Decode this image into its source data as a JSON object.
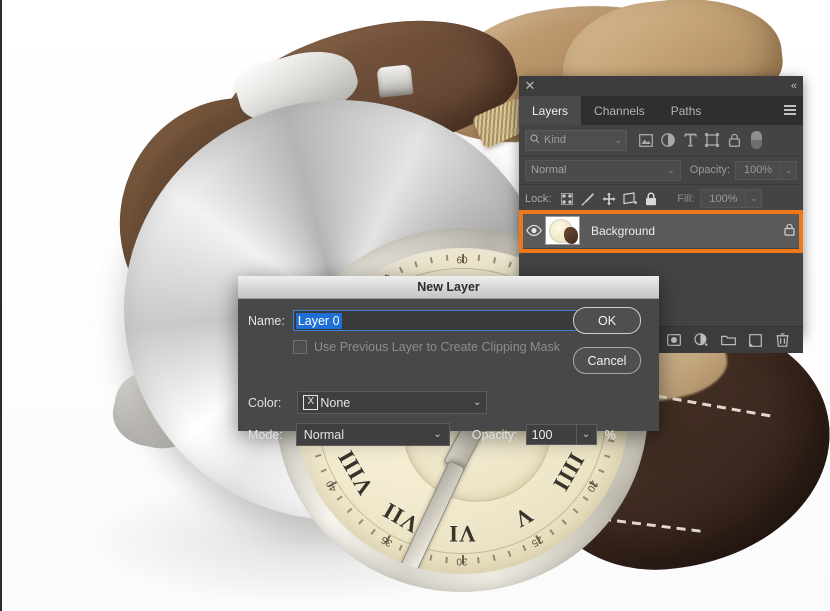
{
  "canvas": {
    "photo_subject": "wristwatch-product-photo",
    "description": "Silver chronograph wristwatch with cream dial, roman numerals and brown leather strap on white background"
  },
  "layers_panel": {
    "close_icon": "✕",
    "collapse_icon": "«",
    "tabs": [
      {
        "label": "Layers",
        "active": true
      },
      {
        "label": "Channels",
        "active": false
      },
      {
        "label": "Paths",
        "active": false
      }
    ],
    "menu_icon": "panel-menu-icon",
    "filter_row": {
      "kind_label": "Kind",
      "search_icon": "🔍",
      "caret": "⌄",
      "filter_icons": [
        "image-filter-icon",
        "adjustment-filter-icon",
        "type-filter-icon",
        "shape-filter-icon",
        "smart-object-filter-icon"
      ],
      "toggle_name": "filter-enable-toggle"
    },
    "blend_row": {
      "blend_mode": "Normal",
      "opacity_label": "Opacity:",
      "opacity_value": "100%",
      "caret": "⌄"
    },
    "lock_row": {
      "lock_label": "Lock:",
      "lock_icons": [
        "transparency-lock-icon",
        "image-lock-icon",
        "position-lock-icon",
        "artboard-lock-icon",
        "all-lock-icon"
      ],
      "fill_label": "Fill:",
      "fill_value": "100%",
      "caret": "⌄"
    },
    "layers": [
      {
        "name": "Background",
        "visible": true,
        "locked": true,
        "eye_icon": "👁",
        "lock_icon": "🔒",
        "highlighted": true
      }
    ],
    "highlight_color": "#f07818",
    "footer_icons": [
      "link-layers-icon",
      "layer-style-icon",
      "add-mask-icon",
      "new-adjustment-layer-icon",
      "new-group-icon",
      "new-layer-icon",
      "delete-layer-icon"
    ]
  },
  "new_layer_dialog": {
    "title": "New Layer",
    "name_label": "Name:",
    "name_value": "Layer 0",
    "clipping_mask_label": "Use Previous Layer to Create Clipping Mask",
    "clipping_mask_checked": false,
    "color_label": "Color:",
    "color_value": "None",
    "color_swatch_icon": "X",
    "mode_label": "Mode:",
    "mode_value": "Normal",
    "opacity_label": "Opacity:",
    "opacity_value": "100",
    "percent_symbol": "%",
    "ok_label": "OK",
    "cancel_label": "Cancel",
    "caret": "⌄"
  }
}
